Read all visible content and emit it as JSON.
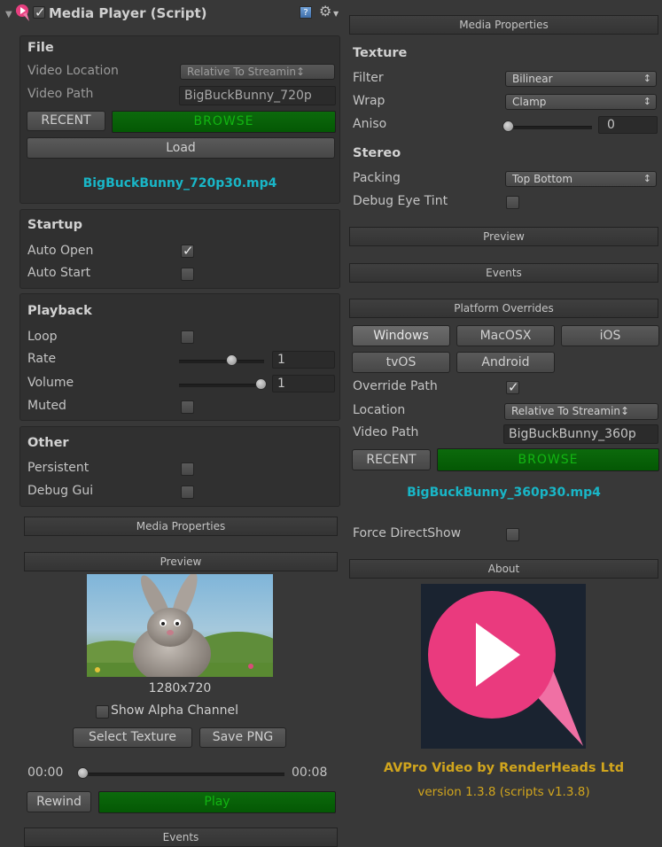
{
  "component": {
    "title": "Media Player (Script)",
    "icons": [
      "foldout-arrow-icon",
      "component-logo-icon",
      "enabled-checkbox",
      "help-icon",
      "settings-gear-icon"
    ]
  },
  "file": {
    "header": "File",
    "video_location_label": "Video Location",
    "video_location_value": "Relative To Streamin↕",
    "video_path_label": "Video Path",
    "video_path_value": "BigBuckBunny_720p",
    "recent": "RECENT",
    "browse": "BROWSE",
    "load": "Load",
    "file_name": "BigBuckBunny_720p30.mp4"
  },
  "startup": {
    "header": "Startup",
    "auto_open": "Auto Open",
    "auto_open_checked": true,
    "auto_start": "Auto Start",
    "auto_start_checked": false
  },
  "playback": {
    "header": "Playback",
    "loop": "Loop",
    "loop_checked": false,
    "rate": "Rate",
    "rate_value": "1",
    "rate_fraction": 0.5,
    "volume": "Volume",
    "volume_value": "1",
    "volume_fraction": 1.0,
    "muted": "Muted",
    "muted_checked": false
  },
  "other": {
    "header": "Other",
    "persistent": "Persistent",
    "debug_gui": "Debug Gui"
  },
  "left_sections": {
    "media_properties": "Media Properties",
    "preview": "Preview",
    "events": "Events"
  },
  "preview": {
    "resolution": "1280x720",
    "show_alpha": "Show Alpha Channel",
    "select_texture": "Select Texture",
    "save_png": "Save PNG",
    "time_start": "00:00",
    "time_end": "00:08",
    "seek_fraction": 0.0,
    "rewind": "Rewind",
    "play": "Play"
  },
  "media_properties": {
    "header": "Media Properties",
    "texture": "Texture",
    "filter_label": "Filter",
    "filter_value": "Bilinear",
    "wrap_label": "Wrap",
    "wrap_value": "Clamp",
    "aniso_label": "Aniso",
    "aniso_value": "0",
    "stereo": "Stereo",
    "packing_label": "Packing",
    "packing_value": "Top Bottom",
    "debug_eye_tint": "Debug Eye Tint"
  },
  "right_sections": {
    "preview": "Preview",
    "events": "Events",
    "platform_overrides": "Platform Overrides",
    "about": "About"
  },
  "platforms": {
    "tabs": [
      "Windows",
      "MacOSX",
      "iOS",
      "tvOS",
      "Android"
    ],
    "selected": "Windows",
    "override_path": "Override Path",
    "override_checked": true,
    "location_label": "Location",
    "location_value": "Relative To Streamin↕",
    "video_path_label": "Video Path",
    "video_path_value": "BigBuckBunny_360p",
    "recent": "RECENT",
    "browse": "BROWSE",
    "file_name": "BigBuckBunny_360p30.mp4"
  },
  "force_directshow": "Force DirectShow",
  "about": {
    "title": "AVPro Video by RenderHeads Ltd",
    "version": "version 1.3.8 (scripts v1.3.8)"
  },
  "colors": {
    "background": "#383838",
    "green_button": "#0a640a",
    "cyan_text": "#19b6c7",
    "yellow_text": "#d1a51d",
    "logo_pink": "#ea3a7e"
  }
}
